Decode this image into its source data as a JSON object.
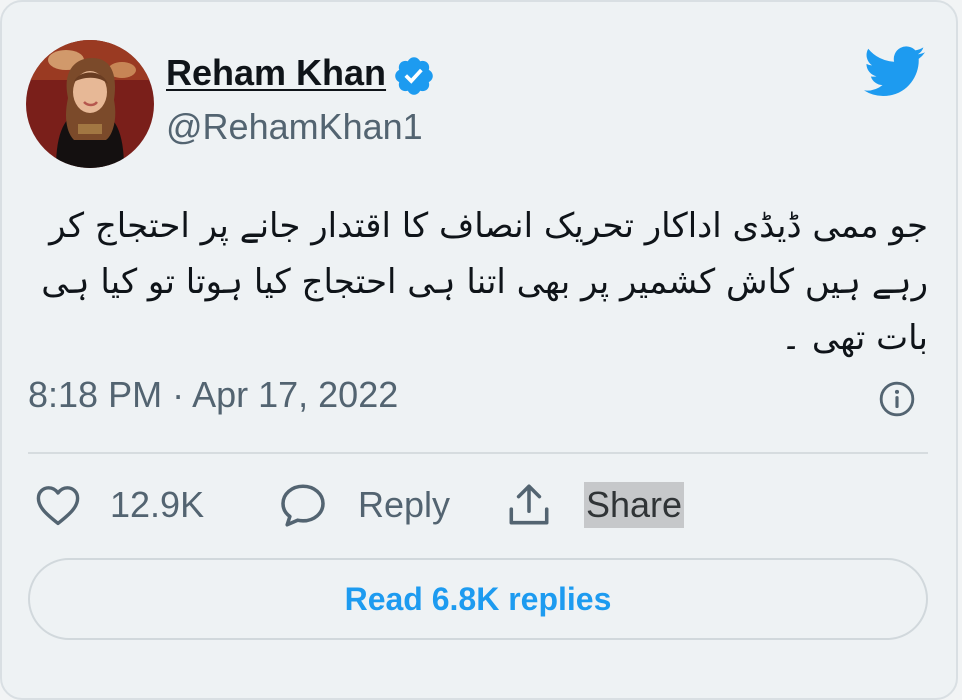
{
  "author": {
    "display_name": "Reham Khan",
    "handle": "@RehamKhan1",
    "verified": true,
    "avatar_icon": "profile-photo"
  },
  "tweet": {
    "text": "جو ممی ڈیڈی اداکار تحریک انصاف کا اقتدار جانے پر  احتجاج کر رہے ہیں کاش کشمیر پر بھی اتنا ہی احتجاج کیا ہوتا تو کیا ہی بات تھی ۔",
    "timestamp": "8:18 PM · Apr 17, 2022"
  },
  "actions": {
    "like_count": "12.9K",
    "reply_label": "Reply",
    "share_label": "Share"
  },
  "footer": {
    "read_replies_label": "Read 6.8K replies"
  },
  "colors": {
    "accent": "#1d9bf0",
    "text_primary": "#0f1419",
    "text_secondary": "#536471",
    "background": "#eef2f4"
  },
  "icons": {
    "brand": "twitter-bird-icon",
    "verified": "verified-badge-icon",
    "info": "info-icon",
    "like": "heart-icon",
    "reply": "speech-bubble-icon",
    "share": "share-upload-icon"
  }
}
